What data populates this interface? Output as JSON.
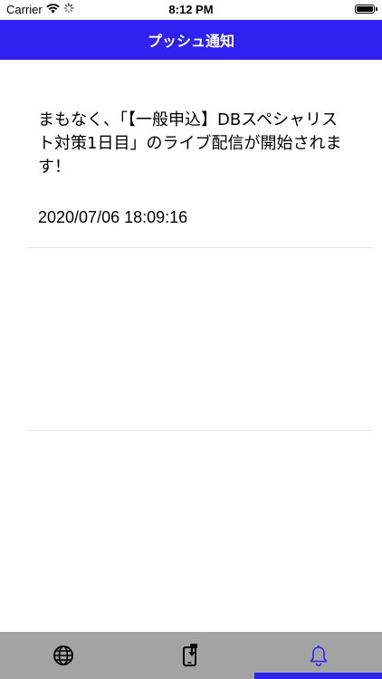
{
  "status_bar": {
    "carrier": "Carrier",
    "time": "8:12 PM"
  },
  "nav": {
    "title": "プッシュ通知"
  },
  "notifications": [
    {
      "message": "まもなく、「【一般申込】DBスペシャリスト対策1日目」のライブ配信が開始されます！",
      "timestamp": "2020/07/06 18:09:16"
    }
  ],
  "tabs": [
    {
      "icon": "globe-icon",
      "selected": false
    },
    {
      "icon": "download-phone-icon",
      "selected": false
    },
    {
      "icon": "bell-icon",
      "selected": true
    }
  ],
  "colors": {
    "accent": "#2f22f0",
    "tab_bar": "#a3a3a3",
    "separator": "#e4e4e4"
  }
}
